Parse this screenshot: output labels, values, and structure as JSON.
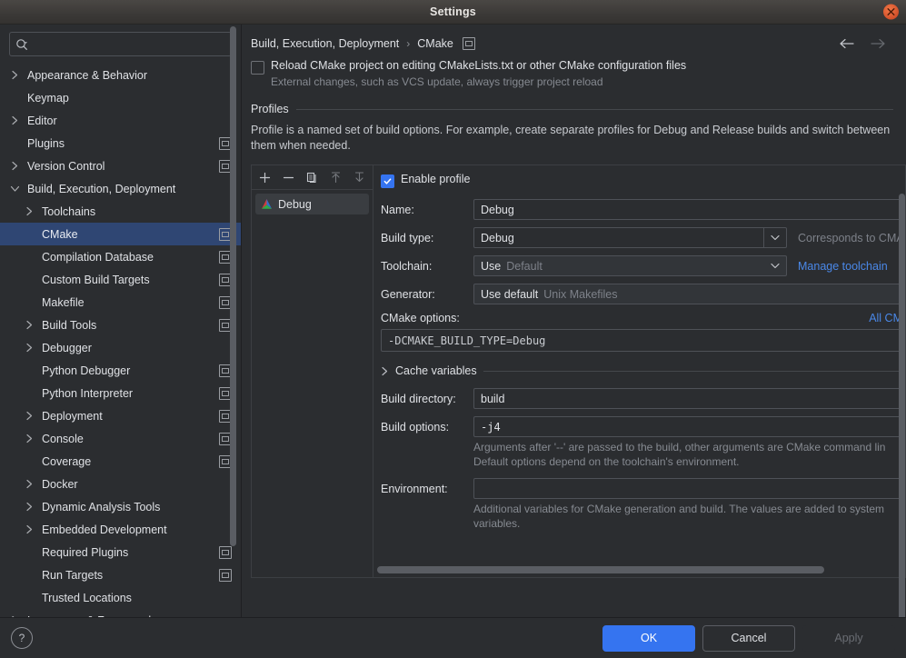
{
  "window": {
    "title": "Settings",
    "close_icon": "close-circle-icon"
  },
  "sidebar": {
    "search": {
      "placeholder": "",
      "value": "",
      "icon": "search-icon"
    },
    "items": [
      {
        "label": "Appearance & Behavior",
        "indent": 0,
        "arrow": "right",
        "badge": false,
        "selected": false
      },
      {
        "label": "Keymap",
        "indent": 0,
        "arrow": "none",
        "badge": false,
        "selected": false
      },
      {
        "label": "Editor",
        "indent": 0,
        "arrow": "right",
        "badge": false,
        "selected": false
      },
      {
        "label": "Plugins",
        "indent": 0,
        "arrow": "none",
        "badge": true,
        "selected": false
      },
      {
        "label": "Version Control",
        "indent": 0,
        "arrow": "right",
        "badge": true,
        "selected": false
      },
      {
        "label": "Build, Execution, Deployment",
        "indent": 0,
        "arrow": "down",
        "badge": false,
        "selected": false
      },
      {
        "label": "Toolchains",
        "indent": 1,
        "arrow": "right",
        "badge": false,
        "selected": false
      },
      {
        "label": "CMake",
        "indent": 1,
        "arrow": "none",
        "badge": true,
        "selected": true
      },
      {
        "label": "Compilation Database",
        "indent": 1,
        "arrow": "none",
        "badge": true,
        "selected": false
      },
      {
        "label": "Custom Build Targets",
        "indent": 1,
        "arrow": "none",
        "badge": true,
        "selected": false
      },
      {
        "label": "Makefile",
        "indent": 1,
        "arrow": "none",
        "badge": true,
        "selected": false
      },
      {
        "label": "Build Tools",
        "indent": 1,
        "arrow": "right",
        "badge": true,
        "selected": false
      },
      {
        "label": "Debugger",
        "indent": 1,
        "arrow": "right",
        "badge": false,
        "selected": false
      },
      {
        "label": "Python Debugger",
        "indent": 1,
        "arrow": "none",
        "badge": true,
        "selected": false
      },
      {
        "label": "Python Interpreter",
        "indent": 1,
        "arrow": "none",
        "badge": true,
        "selected": false
      },
      {
        "label": "Deployment",
        "indent": 1,
        "arrow": "right",
        "badge": true,
        "selected": false
      },
      {
        "label": "Console",
        "indent": 1,
        "arrow": "right",
        "badge": true,
        "selected": false
      },
      {
        "label": "Coverage",
        "indent": 1,
        "arrow": "none",
        "badge": true,
        "selected": false
      },
      {
        "label": "Docker",
        "indent": 1,
        "arrow": "right",
        "badge": false,
        "selected": false
      },
      {
        "label": "Dynamic Analysis Tools",
        "indent": 1,
        "arrow": "right",
        "badge": false,
        "selected": false
      },
      {
        "label": "Embedded Development",
        "indent": 1,
        "arrow": "right",
        "badge": false,
        "selected": false
      },
      {
        "label": "Required Plugins",
        "indent": 1,
        "arrow": "none",
        "badge": true,
        "selected": false
      },
      {
        "label": "Run Targets",
        "indent": 1,
        "arrow": "none",
        "badge": true,
        "selected": false
      },
      {
        "label": "Trusted Locations",
        "indent": 1,
        "arrow": "none",
        "badge": false,
        "selected": false
      },
      {
        "label": "Languages & Frameworks",
        "indent": 0,
        "arrow": "right",
        "badge": false,
        "selected": false
      }
    ]
  },
  "panel": {
    "breadcrumb": {
      "root": "Build, Execution, Deployment",
      "separator": "›",
      "leaf": "CMake"
    },
    "nav": {
      "back_icon": "arrow-left-icon",
      "forward_icon": "arrow-right-icon"
    },
    "reload_checkbox": {
      "label": "Reload CMake project on editing CMakeLists.txt or other CMake configuration files",
      "checked": false,
      "hint": "External changes, such as VCS update, always trigger project reload"
    },
    "profiles_section": {
      "title": "Profiles",
      "description": "Profile is a named set of build options. For example, create separate profiles for Debug and Release builds and switch between them when needed."
    },
    "profile_toolbar": {
      "add": "add-icon",
      "remove": "remove-icon",
      "copy": "copy-icon",
      "move_up": "move-up-icon",
      "move_down": "move-down-icon"
    },
    "profile_list": [
      {
        "label": "Debug",
        "icon": "cmake-logo-icon",
        "selected": true
      }
    ],
    "form": {
      "enable_profile": {
        "label": "Enable profile",
        "checked": true
      },
      "name": {
        "label": "Name:",
        "value": "Debug"
      },
      "build_type": {
        "label": "Build type:",
        "value": "Debug",
        "note": "Corresponds to CMAK"
      },
      "toolchain": {
        "label": "Toolchain:",
        "value": "Use",
        "placeholder": "Default",
        "link": "Manage toolchain"
      },
      "generator": {
        "label": "Generator:",
        "value": "Use default",
        "placeholder": "Unix Makefiles"
      },
      "cmake_options": {
        "label": "CMake options:",
        "link": "All CM",
        "value": "-DCMAKE_BUILD_TYPE=Debug"
      },
      "cache_variables": {
        "label": "Cache variables",
        "expanded": false
      },
      "build_directory": {
        "label": "Build directory:",
        "value": "build"
      },
      "build_options": {
        "label": "Build options:",
        "value": "-j4",
        "hint_line1": "Arguments after '--' are passed to the build, other arguments are CMake command lin",
        "hint_line2": "Default options depend on the toolchain's environment."
      },
      "environment": {
        "label": "Environment:",
        "value": "",
        "hint_line1": "Additional variables for CMake generation and build. The values are added to system",
        "hint_line2": "variables."
      }
    }
  },
  "footer": {
    "help_icon": "help-icon",
    "help_label": "?",
    "ok": "OK",
    "cancel": "Cancel",
    "apply": "Apply"
  },
  "colors": {
    "accent": "#3574f0",
    "selection": "#2f4673",
    "link": "#4a88e8",
    "background": "#2b2d30",
    "close_button": "#d2502a"
  }
}
